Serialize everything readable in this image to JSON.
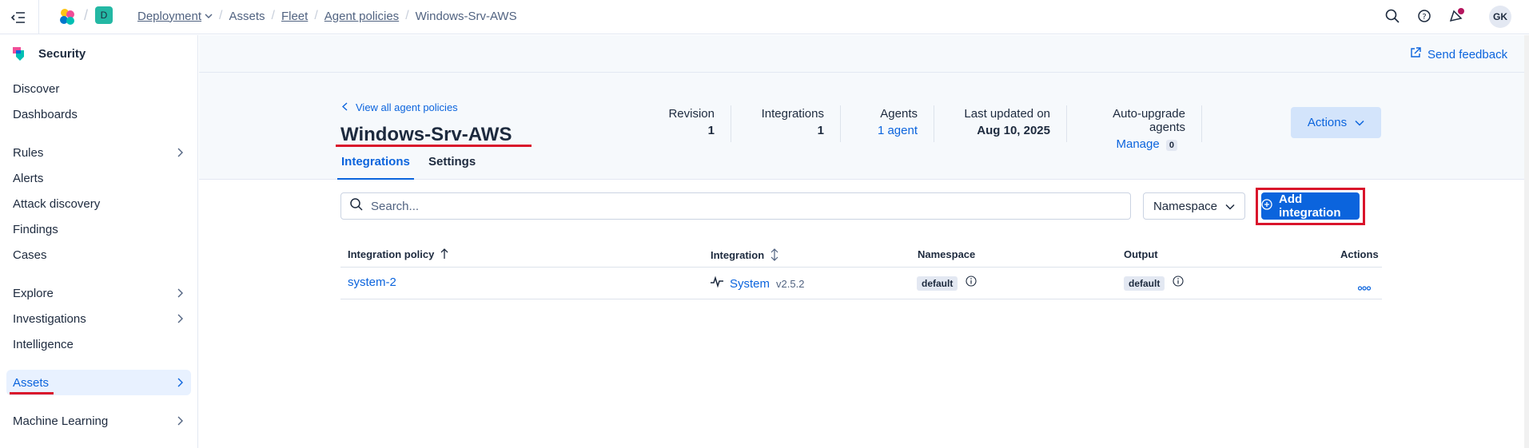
{
  "topbar": {
    "space_letter": "D",
    "breadcrumbs": [
      "Deployment",
      "Assets",
      "Fleet",
      "Agent policies",
      "Windows-Srv-AWS"
    ],
    "avatar": "GK"
  },
  "sidebar": {
    "title": "Security",
    "items": [
      {
        "label": "Discover"
      },
      {
        "label": "Dashboards"
      },
      {
        "label": "Rules"
      },
      {
        "label": "Alerts"
      },
      {
        "label": "Attack discovery"
      },
      {
        "label": "Findings"
      },
      {
        "label": "Cases"
      },
      {
        "label": "Explore"
      },
      {
        "label": "Investigations"
      },
      {
        "label": "Intelligence"
      },
      {
        "label": "Assets"
      },
      {
        "label": "Machine Learning"
      }
    ]
  },
  "page": {
    "send_feedback": "Send feedback",
    "back_link": "View all agent policies",
    "title": "Windows-Srv-AWS",
    "tabs": [
      "Integrations",
      "Settings"
    ],
    "stats": {
      "revision_label": "Revision",
      "revision_value": "1",
      "integrations_label": "Integrations",
      "integrations_value": "1",
      "agents_label": "Agents",
      "agents_value": "1 agent",
      "updated_label": "Last updated on",
      "updated_value": "Aug 10, 2025",
      "autoupgrade_label": "Auto-upgrade agents",
      "autoupgrade_link": "Manage",
      "autoupgrade_count": "0"
    },
    "actions_button": "Actions"
  },
  "toolbar": {
    "search_placeholder": "Search...",
    "namespace_button": "Namespace",
    "add_integration": "Add integration"
  },
  "table": {
    "headers": [
      "Integration policy",
      "Integration",
      "Namespace",
      "Output",
      "Actions"
    ],
    "rows": [
      {
        "policy": "system-2",
        "integration": "System",
        "version": "v2.5.2",
        "namespace": "default",
        "output": "default"
      }
    ]
  },
  "colors": {
    "primary": "#0b64dd",
    "annotation": "#d9142b",
    "link": "#0b64dd"
  }
}
